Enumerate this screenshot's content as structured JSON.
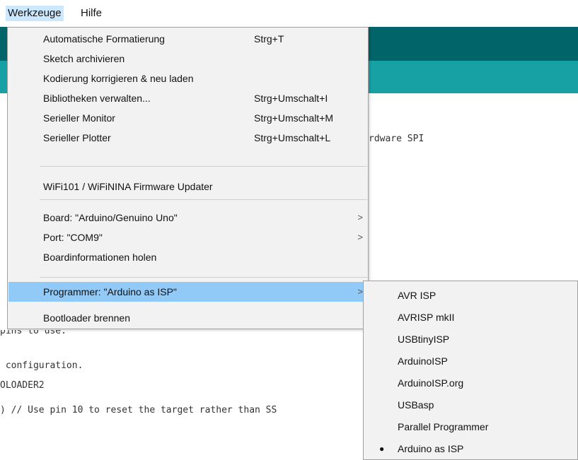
{
  "menubar": {
    "items": [
      "Werkzeuge",
      "Hilfe"
    ]
  },
  "editor": {
    "lines": [
      "rdware SPI",
      "pins to use.",
      " configuration.",
      "OLOADER2",
      ") // Use pin 10 to reset the target rather than SS"
    ]
  },
  "menu": {
    "items": [
      {
        "label": "Automatische Formatierung",
        "shortcut": "Strg+T"
      },
      {
        "label": "Sketch archivieren",
        "shortcut": ""
      },
      {
        "label": "Kodierung korrigieren & neu laden",
        "shortcut": ""
      },
      {
        "label": "Bibliotheken verwalten...",
        "shortcut": "Strg+Umschalt+I"
      },
      {
        "label": "Serieller Monitor",
        "shortcut": "Strg+Umschalt+M"
      },
      {
        "label": "Serieller Plotter",
        "shortcut": "Strg+Umschalt+L"
      },
      {
        "label": "WiFi101 / WiFiNINA Firmware Updater",
        "shortcut": ""
      },
      {
        "label": "Board: \"Arduino/Genuino Uno\"",
        "arrow": ">"
      },
      {
        "label": "Port: \"COM9\"",
        "arrow": ">"
      },
      {
        "label": "Boardinformationen holen",
        "shortcut": ""
      },
      {
        "label": "Programmer: \"Arduino as ISP\"",
        "arrow": ">"
      },
      {
        "label": "Bootloader brennen",
        "shortcut": ""
      }
    ]
  },
  "submenu": {
    "items": [
      {
        "label": "AVR ISP",
        "bullet": ""
      },
      {
        "label": "AVRISP mkII",
        "bullet": ""
      },
      {
        "label": "USBtinyISP",
        "bullet": ""
      },
      {
        "label": "ArduinoISP",
        "bullet": ""
      },
      {
        "label": "ArduinoISP.org",
        "bullet": ""
      },
      {
        "label": "USBasp",
        "bullet": ""
      },
      {
        "label": "Parallel Programmer",
        "bullet": ""
      },
      {
        "label": "Arduino as ISP",
        "bullet": "●"
      }
    ]
  },
  "colors": {
    "menu_highlight": "#91c9f7",
    "menubar_active": "#cce8ff",
    "editor_dark": "#006468",
    "editor_light": "#17a1a5"
  }
}
